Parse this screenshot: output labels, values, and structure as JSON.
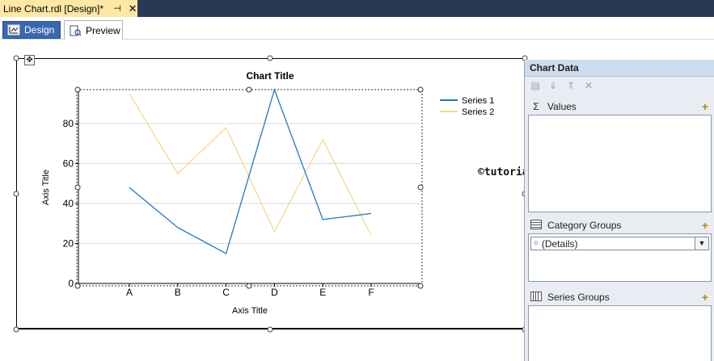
{
  "document_tab": {
    "title": "Line Chart.rdl [Design]*",
    "pin_icon": "pin-icon",
    "close_icon": "close-icon"
  },
  "view_tabs": [
    {
      "label": "Design",
      "icon": "design-icon",
      "active": true
    },
    {
      "label": "Preview",
      "icon": "preview-icon",
      "active": false
    }
  ],
  "watermark": "©tutorialgateway.org",
  "chart_data": {
    "type": "line",
    "title": "Chart Title",
    "xlabel": "Axis Title",
    "ylabel": "Axis Title",
    "categories": [
      "A",
      "B",
      "C",
      "D",
      "E",
      "F"
    ],
    "yticks": [
      0,
      20,
      40,
      60,
      80
    ],
    "ylim": [
      0,
      97
    ],
    "series": [
      {
        "name": "Series 1",
        "color": "#1f78c8",
        "values": [
          48,
          28,
          15,
          97,
          32,
          35
        ]
      },
      {
        "name": "Series 2",
        "color": "#f4d98a",
        "values": [
          95,
          55,
          78,
          26,
          72,
          24
        ]
      }
    ],
    "grid": true,
    "legend": "top-right"
  },
  "chart_data_pane": {
    "title": "Chart Data",
    "toolbar": [
      "properties-icon",
      "move-down-icon",
      "move-up-icon",
      "delete-icon"
    ],
    "values_label": "Values",
    "category_groups_label": "Category Groups",
    "category_value": "(Details)",
    "series_groups_label": "Series Groups",
    "add_icon": "add-icon"
  }
}
